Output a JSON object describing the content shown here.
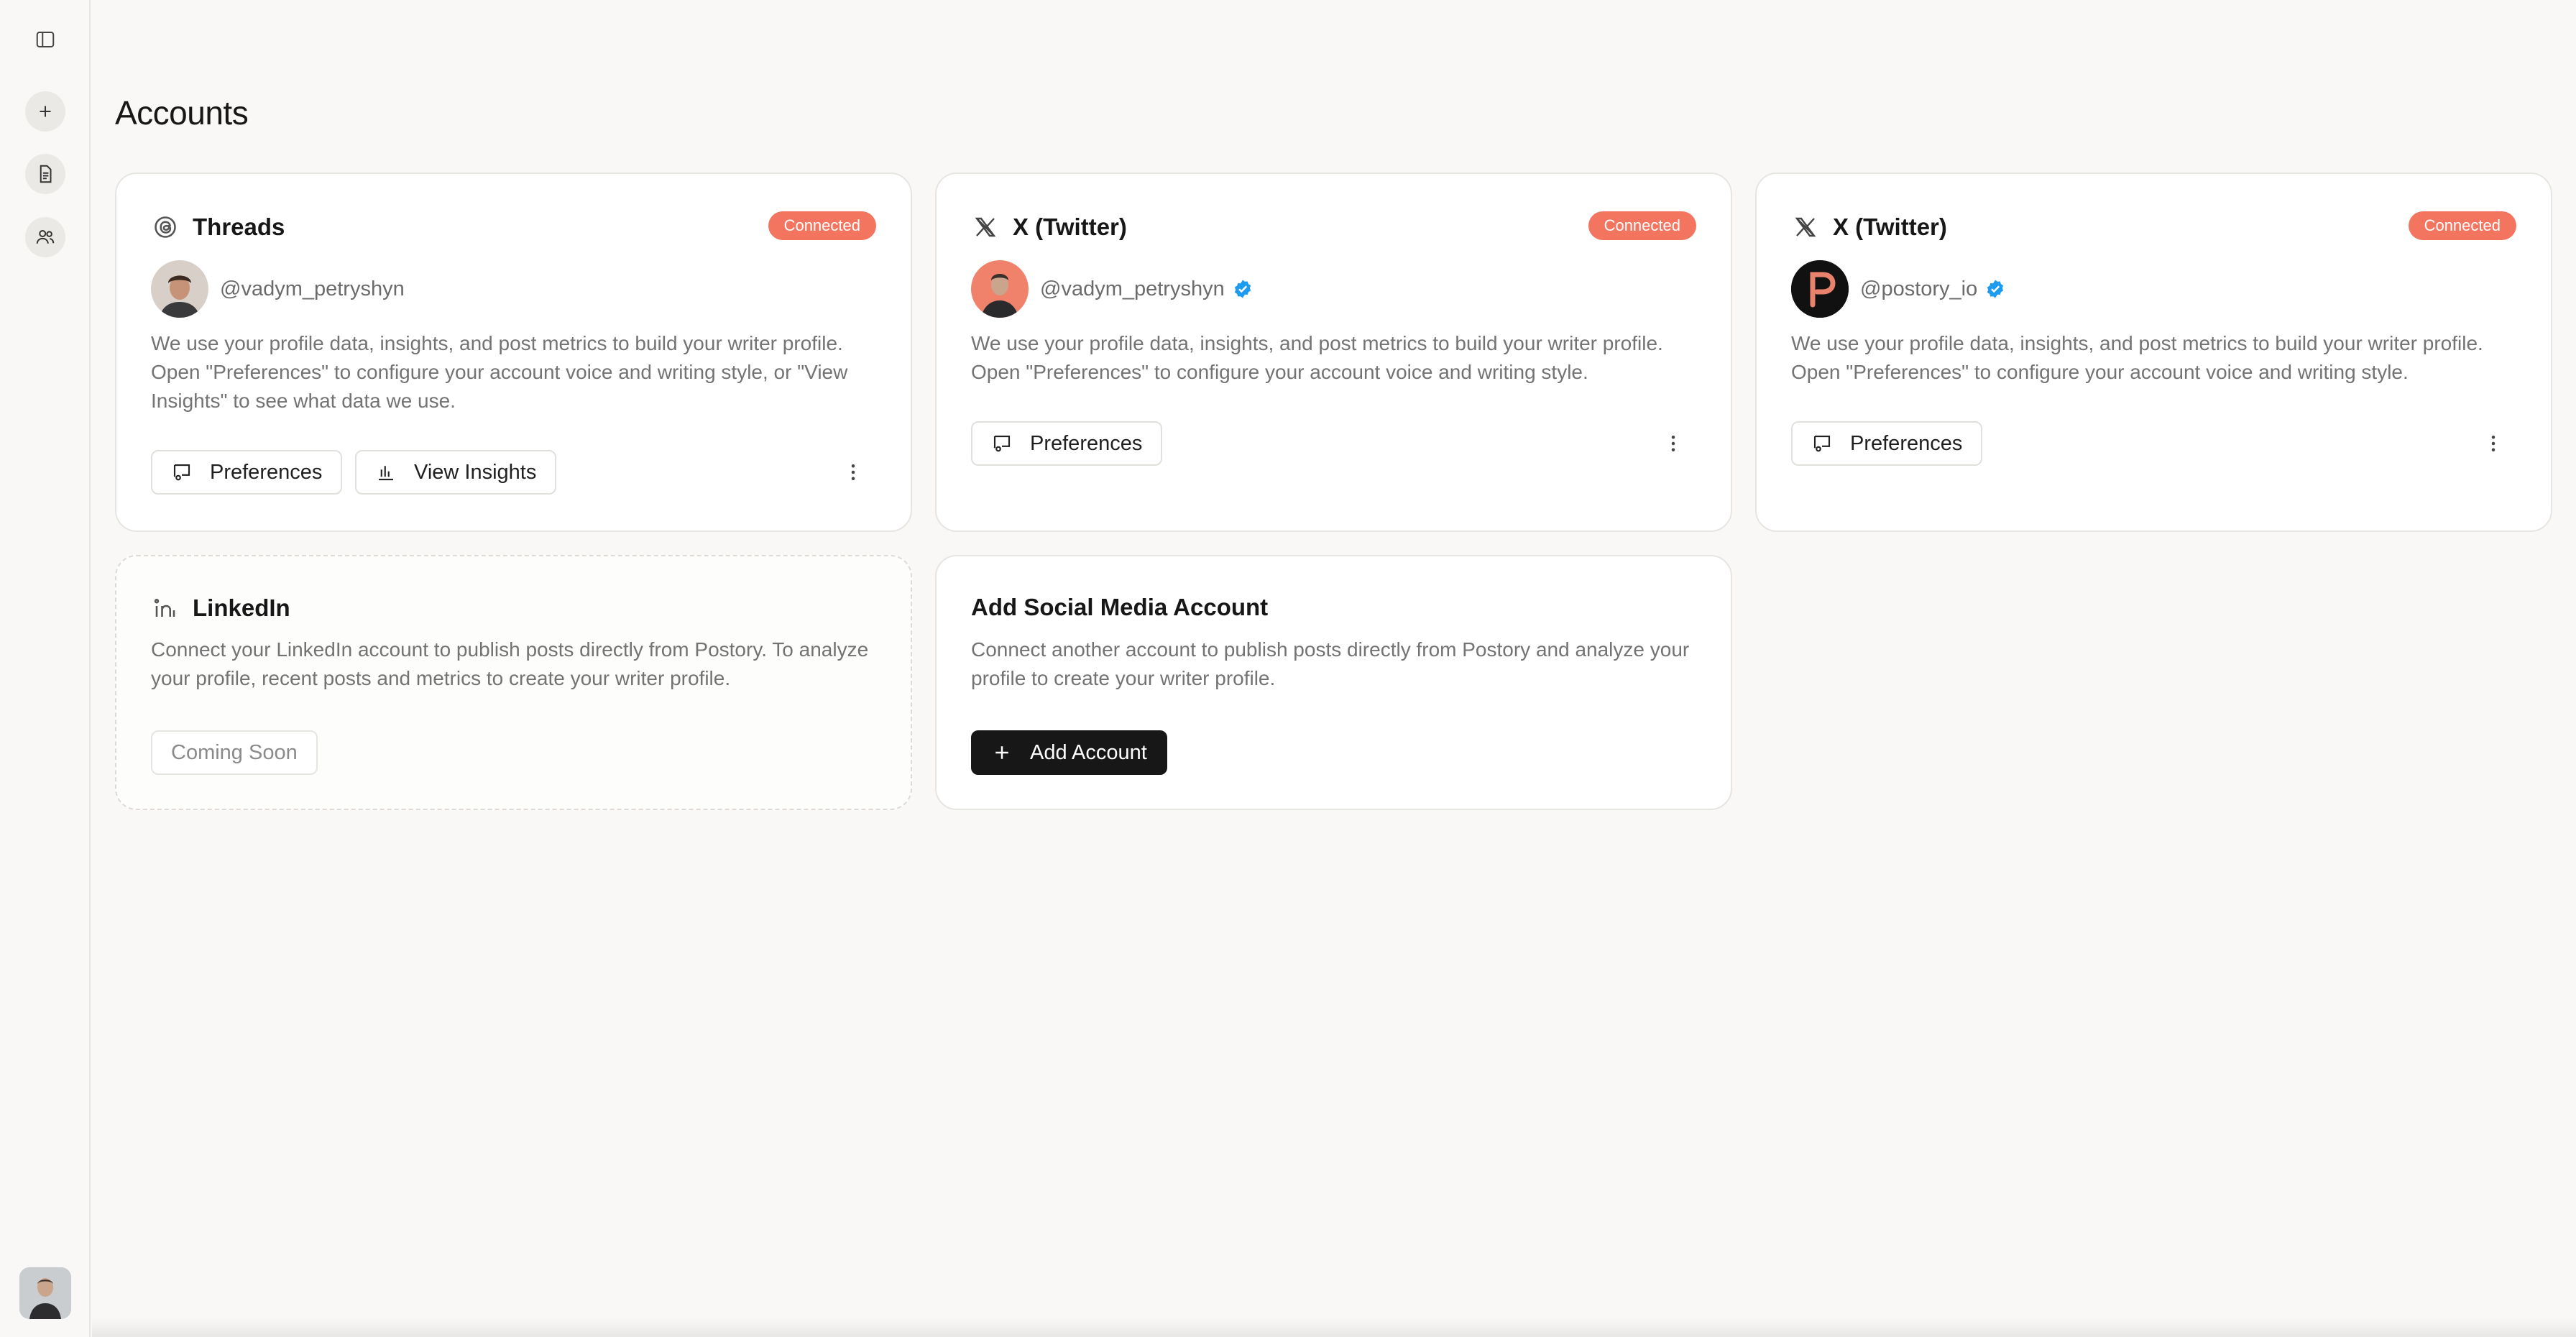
{
  "page": {
    "title": "Accounts"
  },
  "sidebar": {
    "items": [
      {
        "icon": "sidebar-toggle-icon"
      },
      {
        "icon": "plus-icon"
      },
      {
        "icon": "document-icon"
      },
      {
        "icon": "users-icon"
      }
    ],
    "user_avatar": "avatar"
  },
  "cards": [
    {
      "platform": "Threads",
      "icon": "threads-icon",
      "badge": "Connected",
      "handle": "@vadym_petryshyn",
      "verified": false,
      "description": "We use your profile data, insights, and post metrics to build your writer profile. Open \"Preferences\" to configure your account voice and writing style, or \"View Insights\" to see what data we use.",
      "buttons": [
        "Preferences",
        "View Insights"
      ]
    },
    {
      "platform": "X (Twitter)",
      "icon": "x-icon",
      "badge": "Connected",
      "handle": "@vadym_petryshyn",
      "verified": true,
      "description": "We use your profile data, insights, and post metrics to build your writer profile. Open \"Preferences\" to configure your account voice and writing style.",
      "buttons": [
        "Preferences"
      ]
    },
    {
      "platform": "X (Twitter)",
      "icon": "x-icon",
      "badge": "Connected",
      "handle": "@postory_io",
      "verified": true,
      "description": "We use your profile data, insights, and post metrics to build your writer profile. Open \"Preferences\" to configure your account voice and writing style.",
      "buttons": [
        "Preferences"
      ]
    },
    {
      "platform": "LinkedIn",
      "icon": "linkedin-icon",
      "description": "Connect your LinkedIn account to publish posts directly from Postory. To analyze your profile, recent posts and metrics to create your writer profile.",
      "button": "Coming Soon"
    },
    {
      "platform": "Add Social Media Account",
      "description": "Connect another account to publish posts directly from Postory and analyze your profile to create your writer profile.",
      "button": "Add Account"
    }
  ],
  "colors": {
    "badge": "#f3755f",
    "background": "#f9f8f6",
    "verified": "#1d9bf0",
    "dark_button": "#171717"
  }
}
